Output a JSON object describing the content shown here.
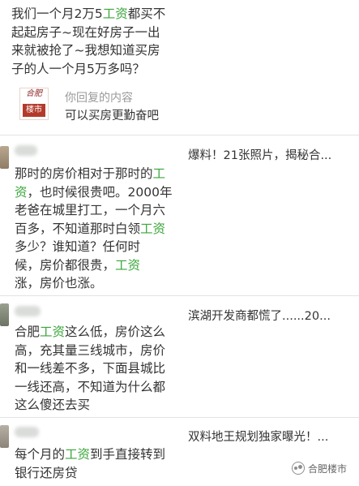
{
  "top_comment": {
    "lines": [
      [
        {
          "t": "我们一个月2万5"
        },
        {
          "t": "工资",
          "kw": true
        },
        {
          "t": "都买不"
        }
      ],
      [
        {
          "t": "起起房子~现在好房子一出"
        }
      ],
      [
        {
          "t": "来就被抢了~我想知道买房"
        }
      ],
      [
        {
          "t": "子的人一个月5万多吗？"
        }
      ]
    ]
  },
  "reply": {
    "logo_top": "合肥",
    "logo_bottom": "楼市",
    "label": "你回复的内容",
    "text": "可以买房更勤奋吧"
  },
  "comments": [
    {
      "lines": [
        [
          {
            "t": "那时的房价相对于那时的"
          },
          {
            "t": "工",
            "kw": true
          }
        ],
        [
          {
            "t": "资",
            "kw": true
          },
          {
            "t": "，也时候很贵吧。2000年"
          }
        ],
        [
          {
            "t": "老爸在城里打工，一个月六"
          }
        ],
        [
          {
            "t": "百多，不知道那时白领"
          },
          {
            "t": "工资",
            "kw": true
          }
        ],
        [
          {
            "t": "多少？谁知道？任何时"
          }
        ],
        [
          {
            "t": "候，房价都很贵，"
          },
          {
            "t": "工资",
            "kw": true
          }
        ],
        [
          {
            "t": "涨，房价也涨。"
          }
        ]
      ],
      "side_headline": "爆料！21张照片，揭秘合..."
    },
    {
      "lines": [
        [
          {
            "t": "合肥"
          },
          {
            "t": "工资",
            "kw": true
          },
          {
            "t": "这么低，房价这么"
          }
        ],
        [
          {
            "t": "高，充其量三线城市，房价"
          }
        ],
        [
          {
            "t": "和一线差不多，下面县城比"
          }
        ],
        [
          {
            "t": "一线还高，不知道为什么都"
          }
        ],
        [
          {
            "t": "这么傻还去买"
          }
        ]
      ],
      "side_headline": "滨湖开发商都慌了......20..."
    },
    {
      "lines": [
        [
          {
            "t": "每个月的"
          },
          {
            "t": "工资",
            "kw": true
          },
          {
            "t": "到手直接转到"
          }
        ],
        [
          {
            "t": "银行还房贷"
          }
        ]
      ],
      "side_headline": "双料地王规划独家曝光！..."
    }
  ],
  "watermark": "合肥楼市",
  "colors": {
    "keyword": "#3aa63a",
    "text": "#333333",
    "muted": "#9a9a9a",
    "divider": "#e3e3e3",
    "logo_red": "#b33a2b"
  },
  "icons": [
    "wechat-icon"
  ]
}
